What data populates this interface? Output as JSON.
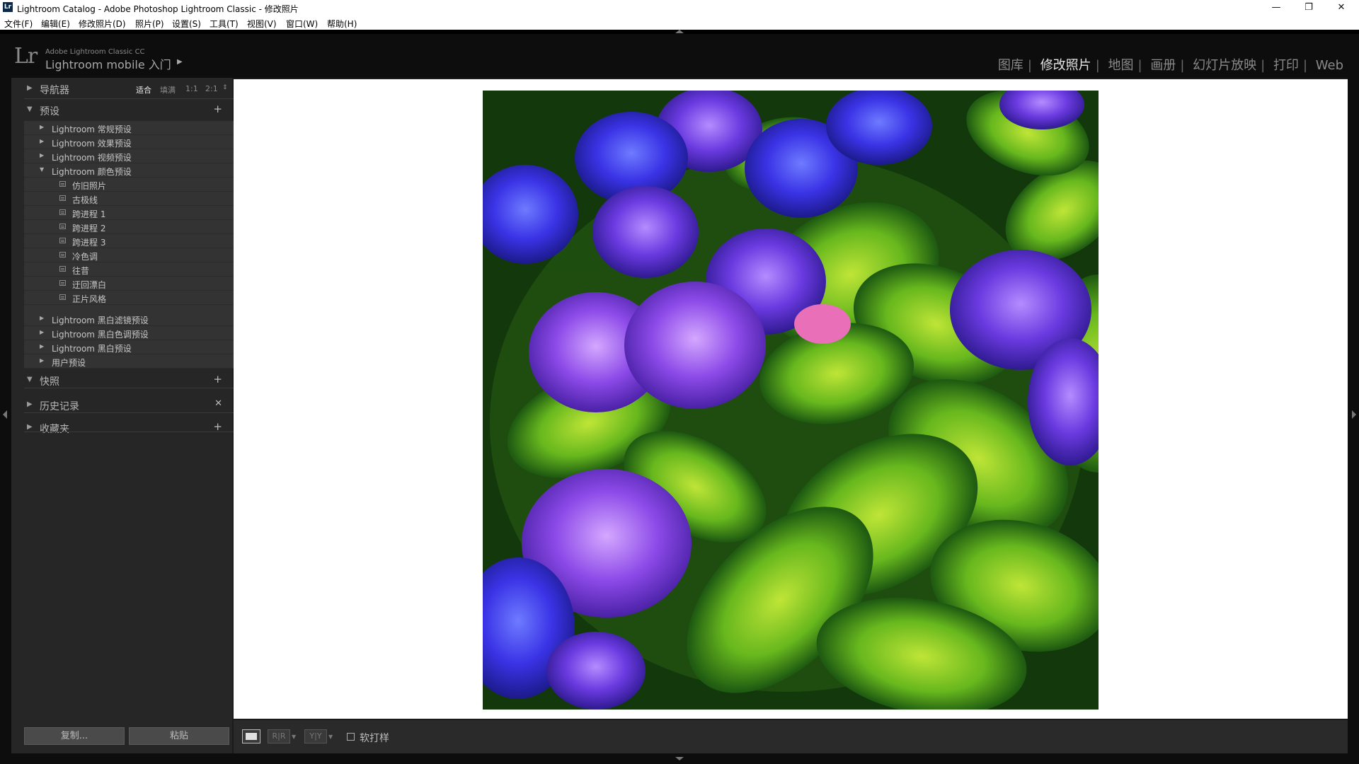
{
  "window": {
    "title": "Lightroom Catalog - Adobe Photoshop Lightroom Classic - 修改照片",
    "icon_text": "Lr"
  },
  "menu": [
    "文件(F)",
    "编辑(E)",
    "修改照片(D)",
    "照片(P)",
    "设置(S)",
    "工具(T)",
    "视图(V)",
    "窗口(W)",
    "帮助(H)"
  ],
  "identity": {
    "logo": "Lr",
    "product": "Adobe Lightroom Classic CC",
    "mobile": "Lightroom mobile 入门"
  },
  "modules": [
    "图库",
    "修改照片",
    "地图",
    "画册",
    "幻灯片放映",
    "打印",
    "Web"
  ],
  "active_module": "修改照片",
  "navigator": {
    "title": "导航器",
    "zoom": [
      "适合",
      "填满",
      "1:1",
      "2:1"
    ],
    "active_zoom": "适合"
  },
  "presets": {
    "title": "预设",
    "groups": [
      {
        "label": "Lightroom 常规预设"
      },
      {
        "label": "Lightroom 效果预设"
      },
      {
        "label": "Lightroom 视频预设"
      },
      {
        "label": "Lightroom 颜色预设",
        "expanded": true,
        "items": [
          "仿旧照片",
          "古极线",
          "跨进程 1",
          "跨进程 2",
          "跨进程 3",
          "冷色调",
          "往昔",
          "迂回漂白",
          "正片风格"
        ]
      },
      {
        "label": "Lightroom 黑白滤镜预设"
      },
      {
        "label": "Lightroom 黑白色调预设"
      },
      {
        "label": "Lightroom 黑白预设"
      },
      {
        "label": "用户预设"
      }
    ]
  },
  "panels": {
    "snapshots": "快照",
    "history": "历史记录",
    "collections": "收藏夹"
  },
  "buttons": {
    "copy": "复制...",
    "paste": "粘贴"
  },
  "toolbar": {
    "view_before_after": "R|R",
    "view_before_after_2": "Y|Y",
    "soft_proof": "软打样",
    "soft_proof_checked": false
  },
  "colors": {
    "panel_bg": "#262626",
    "active_module": "#e6e6e6",
    "inactive_module": "#8a8a8a"
  }
}
